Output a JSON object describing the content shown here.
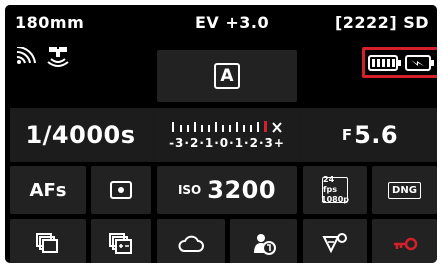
{
  "status": {
    "focal_length": "180mm",
    "ev_label": "EV",
    "ev_value": "+3.0",
    "remaining_storage": "[2222] SD"
  },
  "mode": {
    "exposure_mode": "A"
  },
  "exposure": {
    "shutter_speed": "1/4000s",
    "scale_top": "⁵'''''''''''''''''X",
    "scale_bottom": "-3·2·1·0·1·2·3+",
    "aperture_prefix": "F",
    "aperture_value": "5.6"
  },
  "settings": {
    "focus_mode": "AFs",
    "iso_label": "ISO",
    "iso_value": "3200",
    "video_fps": "24 fps",
    "video_res": "1080p",
    "file_format": "DNG"
  },
  "colors": {
    "highlight": "#d4202a",
    "tile": "#222222",
    "background": "#000000",
    "text": "#ffffff"
  },
  "icons": [
    "wifi-icon",
    "gps-satellite-icon",
    "battery-icon",
    "sd-card-battery-icon",
    "spot-metering-icon",
    "drive-mode-icon",
    "exposure-bracketing-icon",
    "white-balance-cloud-icon",
    "user-profile-icon",
    "focus-peaking-icon",
    "key-lock-icon"
  ]
}
